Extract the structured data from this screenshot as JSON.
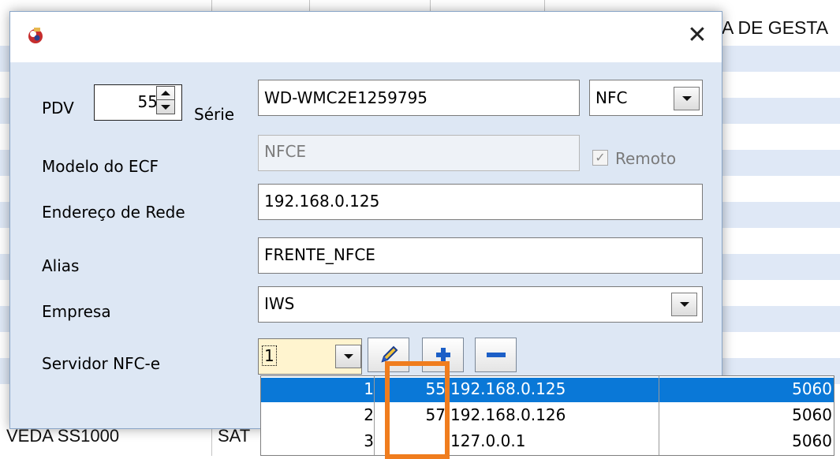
{
  "background_window": {
    "header_text": "A DE GESTA",
    "bottom_cells": [
      "VEDA SS1000",
      "SAT"
    ]
  },
  "dialog": {
    "close_glyph": "✕",
    "labels": {
      "pdv": "PDV",
      "serie": "Série",
      "modelo": "Modelo do ECF",
      "endereco": "Endereço de Rede",
      "alias": "Alias",
      "empresa": "Empresa",
      "servidor": "Servidor NFC-e",
      "remoto": "Remoto"
    },
    "fields": {
      "pdv": "55",
      "serie": "WD-WMC2E1259795",
      "tipo": "NFC",
      "modelo": "NFCE",
      "remoto_checked": true,
      "endereco": "192.168.0.125",
      "alias": "FRENTE_NFCE",
      "empresa": "IWS",
      "servidor": "1"
    },
    "icons": {
      "app": "app-icon",
      "close": "close-icon",
      "edit": "pencil-icon",
      "add": "plus-icon",
      "remove": "minus-icon"
    }
  },
  "servidor_list": {
    "selected_index": 0,
    "rows": [
      {
        "idx": "1",
        "pdv": "55",
        "ip": "192.168.0.125",
        "port": "5060"
      },
      {
        "idx": "2",
        "pdv": "57",
        "ip": "192.168.0.126",
        "port": "5060"
      },
      {
        "idx": "3",
        "pdv": "",
        "ip": "127.0.0.1",
        "port": "5060"
      }
    ]
  },
  "colors": {
    "selection": "#0a78d7",
    "highlight_box": "#f07d1e",
    "client_bg": "#dde7f4",
    "alt_row": "#dfe8f6"
  }
}
